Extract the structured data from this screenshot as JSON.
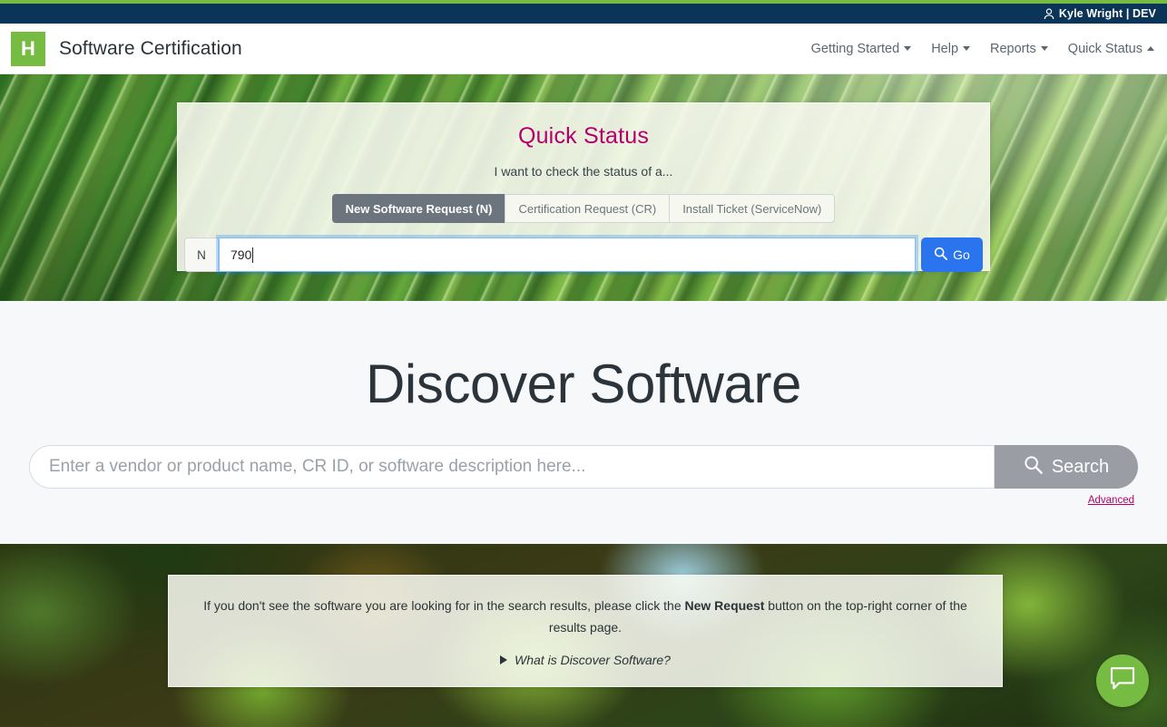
{
  "utility_bar": {
    "user_icon": "person-icon",
    "user_label": "Kyle Wright | DEV"
  },
  "header": {
    "logo_letter": "H",
    "app_title": "Software Certification",
    "nav_items": [
      {
        "label": "Getting Started",
        "caret": "down"
      },
      {
        "label": "Help",
        "caret": "down"
      },
      {
        "label": "Reports",
        "caret": "down"
      },
      {
        "label": "Quick Status",
        "caret": "up"
      }
    ]
  },
  "quick_status": {
    "title": "Quick Status",
    "subtitle": "I want to check the status of a...",
    "tabs": [
      {
        "label": "New Software Request (N)",
        "active": true
      },
      {
        "label": "Certification Request (CR)",
        "active": false
      },
      {
        "label": "Install Ticket (ServiceNow)",
        "active": false
      }
    ],
    "input_prefix": "N",
    "input_value": "790",
    "go_label": "Go",
    "go_icon": "search-icon",
    "accent_color": "#b5006b",
    "go_button_color": "#2a74f0"
  },
  "discover": {
    "title": "Discover Software",
    "search_placeholder": "Enter a vendor or product name, CR ID, or software description here...",
    "search_value": "",
    "search_button_label": "Search",
    "search_icon": "search-icon",
    "advanced_label": "Advanced"
  },
  "info_card": {
    "text_before": "If you don't see the software you are looking for in the search results, please click the ",
    "text_bold": "New Request",
    "text_after": " button on the top-right corner of the results page.",
    "expander_label": "What is Discover Software?",
    "expander_icon": "triangle-right-icon"
  },
  "chat": {
    "icon": "chat-bubble-icon"
  }
}
